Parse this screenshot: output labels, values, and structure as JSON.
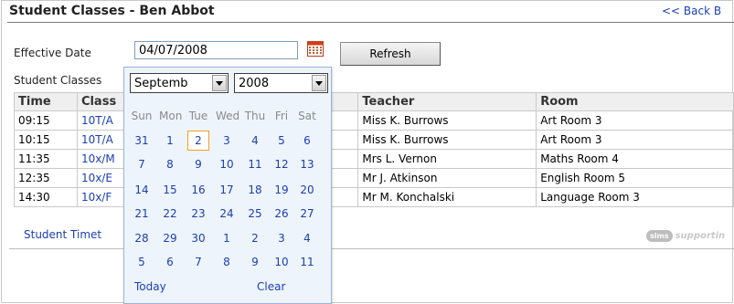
{
  "header": {
    "title": "Student Classes - Ben Abbot",
    "back_link": "<< Back B"
  },
  "form": {
    "effective_date_label": "Effective Date",
    "effective_date_value": "04/07/2008",
    "refresh_label": "Refresh",
    "student_classes_label": "Student Classes"
  },
  "table": {
    "headers": {
      "time": "Time",
      "class": "Class",
      "teacher": "Teacher",
      "room": "Room"
    },
    "rows": [
      {
        "time": "09:15",
        "class": "10T/A",
        "teacher": "Miss K. Burrows",
        "room": "Art Room 3"
      },
      {
        "time": "10:15",
        "class": "10T/A",
        "teacher": "Miss K. Burrows",
        "room": "Art Room 3"
      },
      {
        "time": "11:35",
        "class": "10x/M",
        "teacher": "Mrs L. Vernon",
        "room": "Maths Room 4"
      },
      {
        "time": "12:35",
        "class": "10x/E",
        "teacher": "Mr J. Atkinson",
        "room": "English Room 5"
      },
      {
        "time": "14:30",
        "class": "10x/F",
        "teacher": "Mr M. Konchalski",
        "room": "Language Room 3"
      }
    ]
  },
  "footer": {
    "timetable_link": "Student Timet",
    "logo_badge": "sims",
    "logo_text": "supportin"
  },
  "calendar": {
    "month": "Septemb",
    "year": "2008",
    "weekdays": [
      "Sun",
      "Mon",
      "Tue",
      "Wed",
      "Thu",
      "Fri",
      "Sat"
    ],
    "weeks": [
      [
        "31",
        "1",
        "2",
        "3",
        "4",
        "5",
        "6"
      ],
      [
        "7",
        "8",
        "9",
        "10",
        "11",
        "12",
        "13"
      ],
      [
        "14",
        "15",
        "16",
        "17",
        "18",
        "19",
        "20"
      ],
      [
        "21",
        "22",
        "23",
        "24",
        "25",
        "26",
        "27"
      ],
      [
        "28",
        "29",
        "30",
        "1",
        "2",
        "3",
        "4"
      ],
      [
        "5",
        "6",
        "7",
        "8",
        "9",
        "10",
        "11"
      ]
    ],
    "today_label": "Today",
    "clear_label": "Clear"
  },
  "colors": {
    "link": "#1a3fb3",
    "highlight_border": "#f0a020",
    "calendar_bg": "#eef4fb"
  },
  "icons": {
    "calendar": "calendar-icon",
    "dropdown": "chevron-down-icon"
  }
}
